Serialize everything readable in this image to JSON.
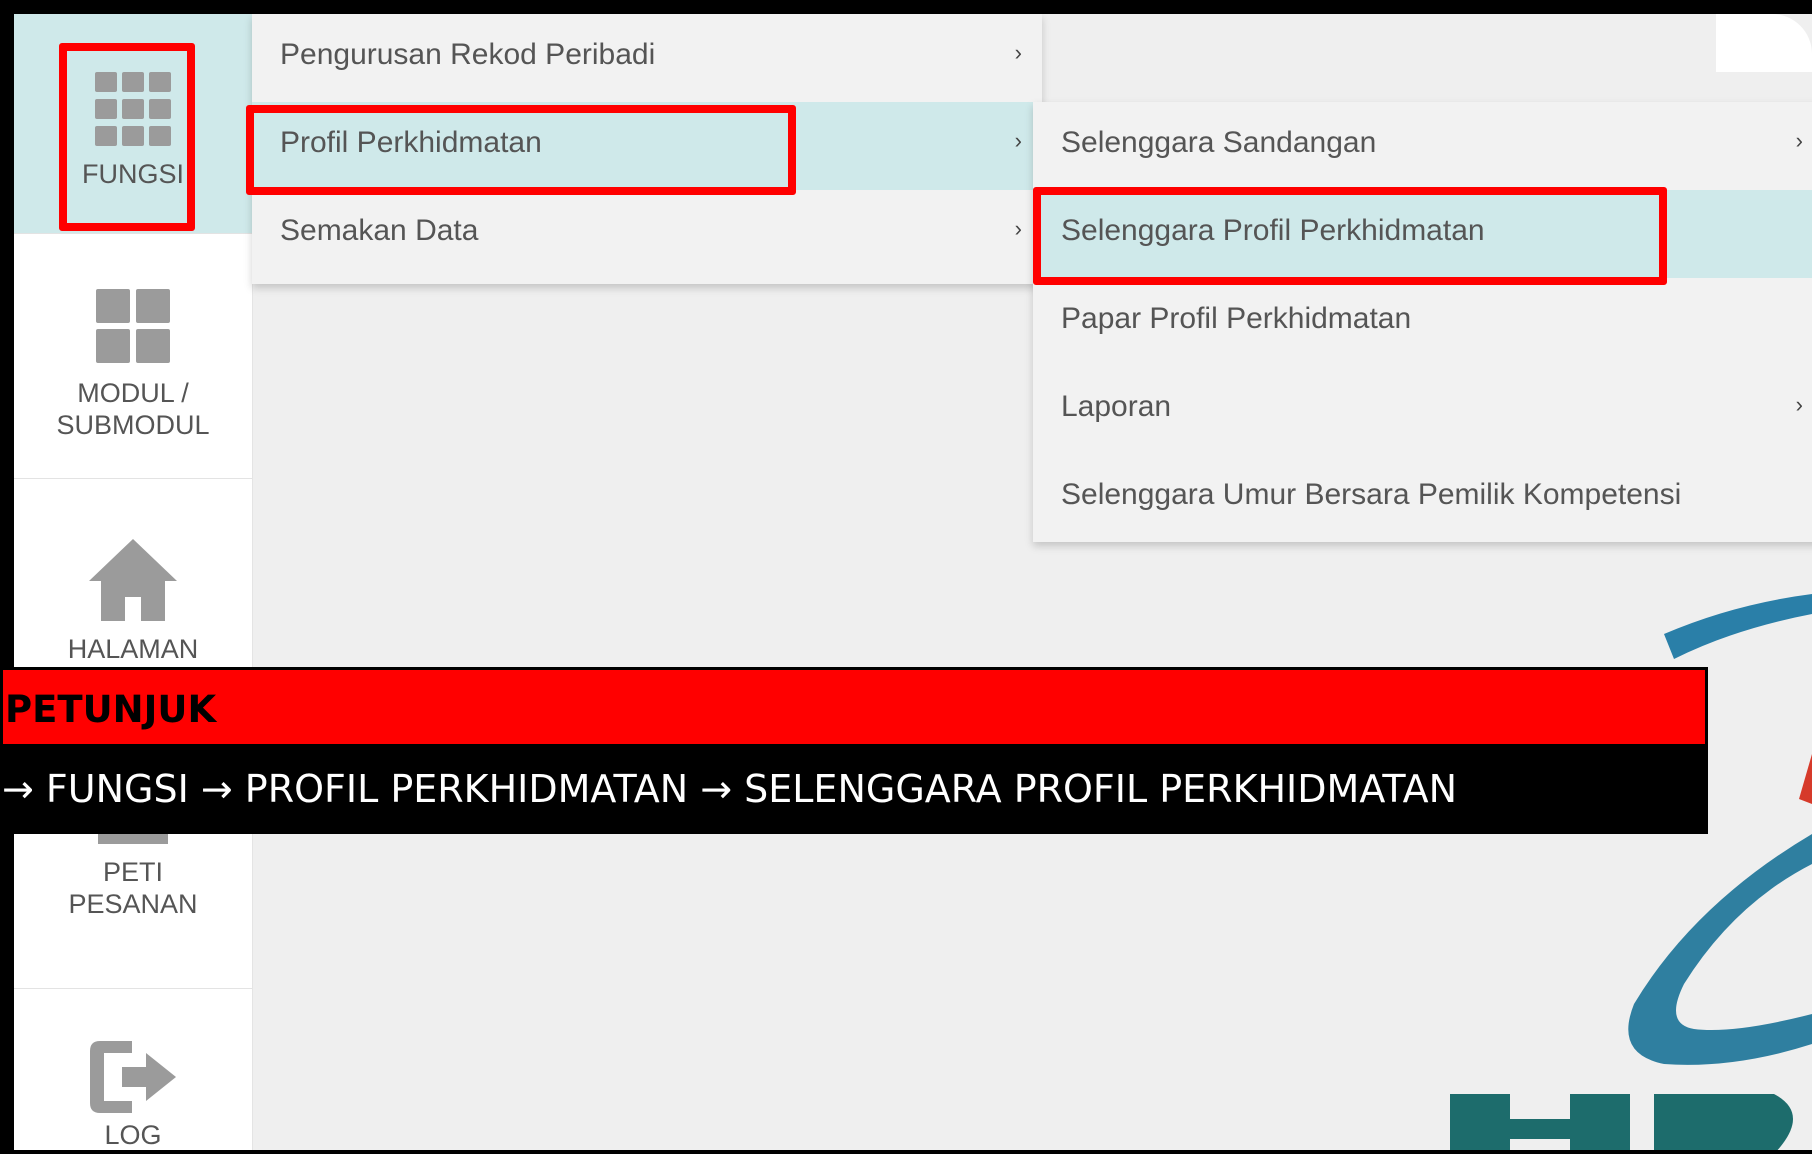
{
  "sidebar": {
    "items": [
      {
        "label": "FUNGSI",
        "icon": "grid-icon"
      },
      {
        "label": "MODUL /\nSUBMODUL",
        "icon": "four-squares-icon"
      },
      {
        "label": "HALAMAN\nUTAMA",
        "icon": "home-icon"
      },
      {
        "label": "PETI\nPESANAN",
        "icon": "inbox-icon"
      },
      {
        "label": "LOG",
        "icon": "logout-icon"
      }
    ]
  },
  "menu_level1": {
    "items": [
      {
        "label": "Pengurusan Rekod Peribadi",
        "chevron": "›"
      },
      {
        "label": "Profil Perkhidmatan",
        "chevron": "›"
      },
      {
        "label": "Semakan Data",
        "chevron": "›"
      }
    ]
  },
  "menu_level2": {
    "items": [
      {
        "label": "Selenggara Sandangan",
        "chevron": "›"
      },
      {
        "label": "Selenggara Profil Perkhidmatan",
        "chevron": ""
      },
      {
        "label": "Papar Profil Perkhidmatan",
        "chevron": ""
      },
      {
        "label": "Laporan",
        "chevron": "›"
      },
      {
        "label": "Selenggara Umur Bersara Pemilik Kompetensi",
        "chevron": ""
      }
    ]
  },
  "guide": {
    "title": "PETUNJUK",
    "path": "→ FUNGSI → PROFIL PERKHIDMATAN → SELENGGARA PROFIL PERKHIDMATAN"
  },
  "colors": {
    "highlight_box": "#ff0000",
    "active_bg": "#cfe9ea"
  }
}
